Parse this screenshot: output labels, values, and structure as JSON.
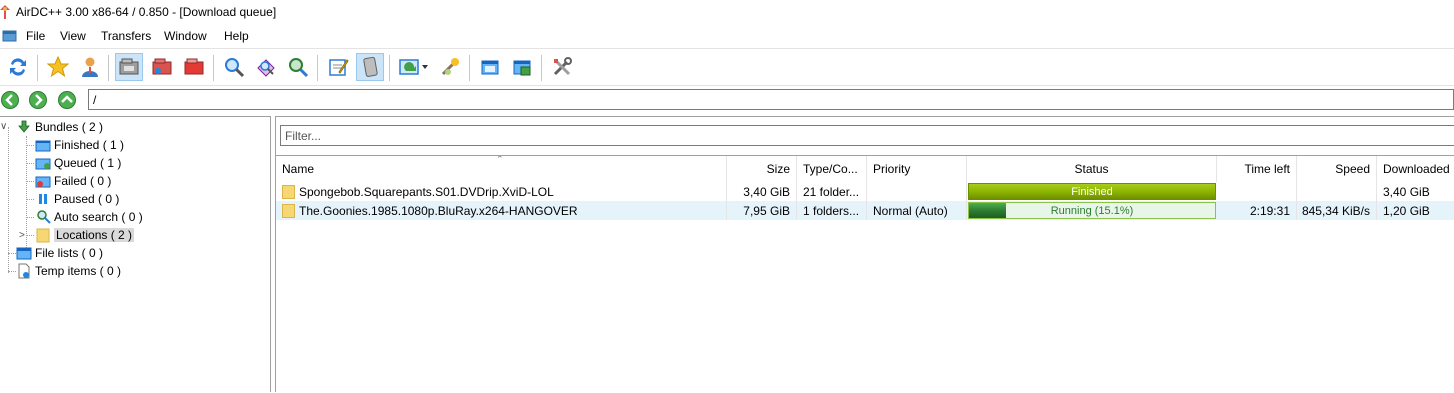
{
  "window": {
    "title": "AirDC++ 3.00 x86-64 / 0.850 - [Download queue]"
  },
  "menu": {
    "items": [
      "File",
      "View",
      "Transfers",
      "Window",
      "Help"
    ]
  },
  "address": {
    "path": "/"
  },
  "tree": {
    "bundles": "Bundles ( 2 )",
    "finished": "Finished ( 1 )",
    "queued": "Queued ( 1 )",
    "failed": "Failed ( 0 )",
    "paused": "Paused ( 0 )",
    "auto_search": "Auto search ( 0 )",
    "locations": "Locations ( 2 )",
    "file_lists": "File lists ( 0 )",
    "temp_items": "Temp items ( 0 )"
  },
  "filter": {
    "placeholder": "Filter..."
  },
  "columns": {
    "name": "Name",
    "size": "Size",
    "type": "Type/Co...",
    "priority": "Priority",
    "status": "Status",
    "time_left": "Time left",
    "speed": "Speed",
    "downloaded": "Downloaded"
  },
  "rows": [
    {
      "name": "Spongebob.Squarepants.S01.DVDrip.XviD-LOL",
      "size": "3,40 GiB",
      "type": "21 folder...",
      "priority": "",
      "status": "Finished",
      "progress": 1.0,
      "time_left": "",
      "speed": "",
      "downloaded": "3,40 GiB"
    },
    {
      "name": "The.Goonies.1985.1080p.BluRay.x264-HANGOVER",
      "size": "7,95 GiB",
      "type": "1 folders...",
      "priority": "Normal (Auto)",
      "status": "Running (15.1%)",
      "progress": 0.151,
      "time_left": "2:19:31",
      "speed": "845,34 KiB/s",
      "downloaded": "1,20 GiB"
    }
  ],
  "colors": {
    "finished_bar": "#8db600",
    "running_bar": "#2e7d32",
    "running_text": "#2e7d32",
    "selection": "#e5f3fb"
  },
  "icons": {
    "toolbar": [
      "reconnect-icon",
      "favorite-hubs-icon",
      "users-icon",
      "queue-icon",
      "finished-downloads-icon",
      "finished-uploads-icon",
      "search-icon",
      "adl-search-icon",
      "search-spy-icon",
      "notepad-icon",
      "system-log-icon",
      "refresh-share-icon",
      "settings-wizard-icon",
      "open-file-list-icon",
      "open-own-list-icon",
      "settings-icon"
    ]
  }
}
